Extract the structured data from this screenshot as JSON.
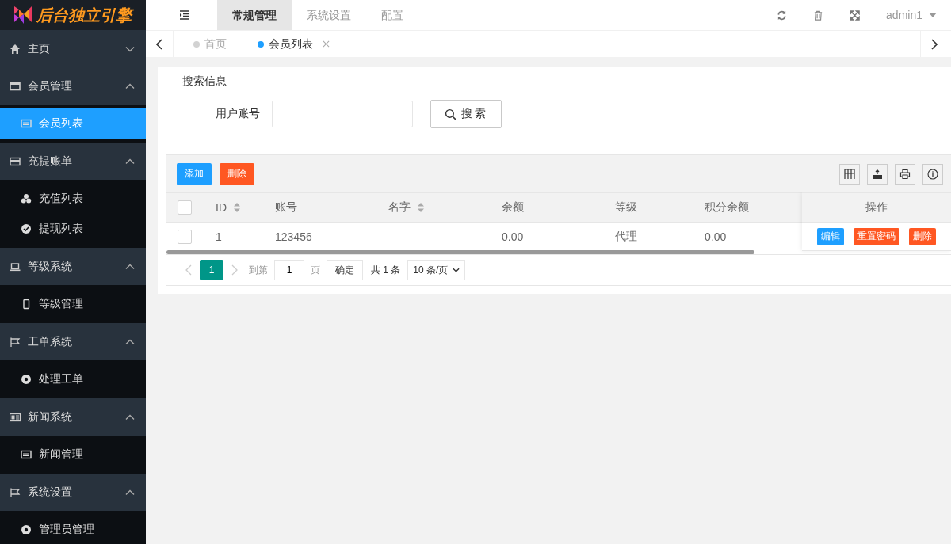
{
  "brand": {
    "name": "后台独立引擎"
  },
  "top_nav": {
    "tabs": [
      {
        "label": "常规管理",
        "selected": true
      },
      {
        "label": "系统设置",
        "selected": false
      },
      {
        "label": "配置",
        "selected": false
      }
    ],
    "user": "admin1"
  },
  "page_tabs": [
    {
      "label": "首页",
      "selected": false,
      "closable": false
    },
    {
      "label": "会员列表",
      "selected": true,
      "closable": true
    }
  ],
  "sidebar": {
    "groups": [
      {
        "label": "主页",
        "expanded": false
      },
      {
        "label": "会员管理",
        "expanded": true,
        "children": [
          {
            "label": "会员列表",
            "selected": true
          }
        ]
      },
      {
        "label": "充提账单",
        "expanded": true,
        "children": [
          {
            "label": "充值列表",
            "selected": false
          },
          {
            "label": "提现列表",
            "selected": false
          }
        ]
      },
      {
        "label": "等级系统",
        "expanded": true,
        "children": [
          {
            "label": "等级管理",
            "selected": false
          }
        ]
      },
      {
        "label": "工单系统",
        "expanded": true,
        "children": [
          {
            "label": "处理工单",
            "selected": false
          }
        ]
      },
      {
        "label": "新闻系统",
        "expanded": true,
        "children": [
          {
            "label": "新闻管理",
            "selected": false
          }
        ]
      },
      {
        "label": "系统设置",
        "expanded": true,
        "children": [
          {
            "label": "管理员管理",
            "selected": false
          }
        ]
      }
    ]
  },
  "search": {
    "legend": "搜索信息",
    "label": "用户账号",
    "button": "搜索"
  },
  "toolbar": [
    {
      "label": "添加",
      "kind": "primary"
    },
    {
      "label": "删除",
      "kind": "danger"
    }
  ],
  "table": {
    "header_checked": false,
    "columns": [
      {
        "label": "ID",
        "sortable": true
      },
      {
        "label": "账号",
        "sortable": false
      },
      {
        "label": "名字",
        "sortable": true
      },
      {
        "label": "余额",
        "sortable": false
      },
      {
        "label": "等级",
        "sortable": false
      },
      {
        "label": "积分余额",
        "sortable": false
      }
    ],
    "actions_label": "操作",
    "rows": [
      {
        "selected": false,
        "cells": [
          "1",
          "123456",
          "",
          "0.00",
          "代理",
          "0.00"
        ],
        "actions": [
          {
            "label": "编辑",
            "kind": "primary"
          },
          {
            "label": "重置密码",
            "kind": "danger"
          },
          {
            "label": "删除",
            "kind": "danger"
          }
        ]
      }
    ]
  },
  "pagination": {
    "pages": [
      {
        "label": "1",
        "selected": true
      }
    ],
    "goto_label": "到第",
    "goto_value": "1",
    "page_unit": "页",
    "confirm": "确定",
    "total": "共 1 条",
    "page_size": "10 条/页"
  }
}
